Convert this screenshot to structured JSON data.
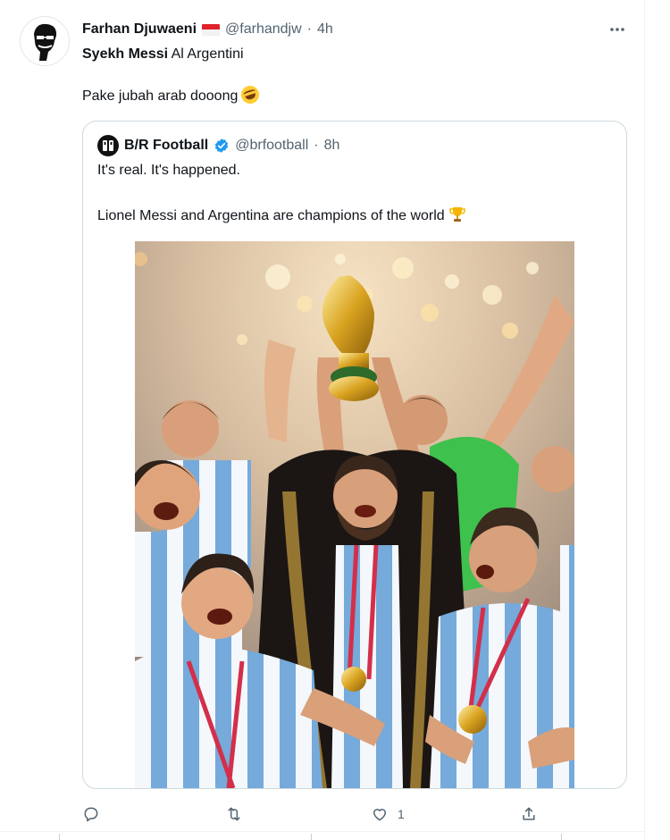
{
  "tweet": {
    "display_name": "Farhan Djuwaeni",
    "handle": "@farhandjw",
    "time": "4h",
    "separator": "·",
    "text_bold": "Syekh Messi",
    "text_rest": " Al Argentini",
    "text_line2": "Pake jubah arab dooong",
    "emoji": "rolling-on-floor-laughing-emoji",
    "flag": "indonesia-flag"
  },
  "quote": {
    "display_name": "B/R Football",
    "handle": "@brfootball",
    "time": "8h",
    "separator": "·",
    "line1": "It's real. It's happened.",
    "line2": "Lionel Messi and Argentina are champions of the world",
    "emoji": "trophy-emoji",
    "verified": "verified-badge-icon"
  },
  "actions": {
    "reply_count": "",
    "retweet_count": "",
    "like_count": "1",
    "share_count": ""
  },
  "colors": {
    "muted": "#536471",
    "verified": "#1d9bf0",
    "border": "#cfd9de",
    "albiceleste": "#75aadb"
  }
}
